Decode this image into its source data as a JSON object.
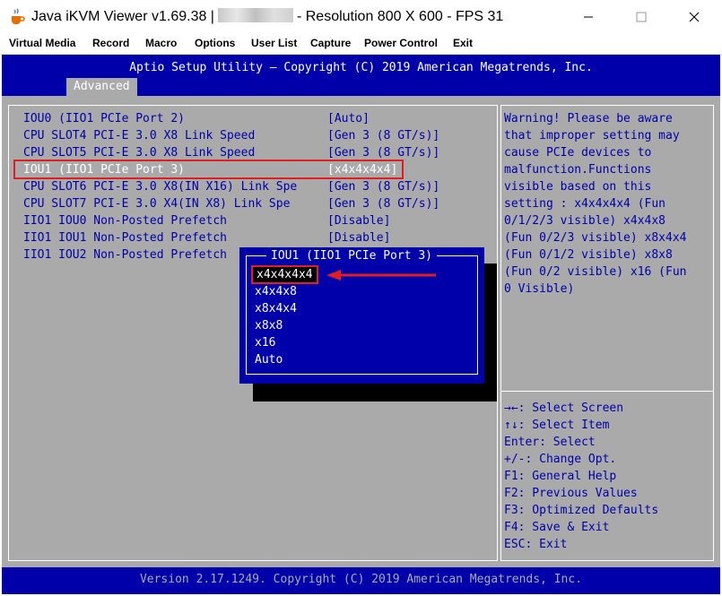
{
  "window": {
    "title_prefix": "Java iKVM Viewer v1.69.38 |",
    "title_suffix": "- Resolution 800 X 600 - FPS 31",
    "icon": "java-cup-icon"
  },
  "menu": [
    "Virtual Media",
    "Record",
    "Macro",
    "Options",
    "User List",
    "Capture",
    "Power Control",
    "Exit"
  ],
  "bios": {
    "header_title": "Aptio Setup Utility – Copyright (C) 2019 American Megatrends, Inc.",
    "tab": "Advanced",
    "footer": "Version 2.17.1249. Copyright (C) 2019 American Megatrends, Inc.",
    "settings": [
      {
        "label": "IOU0 (IIO1 PCIe Port 2)",
        "value": "[Auto]"
      },
      {
        "label": "CPU SLOT4 PCI-E 3.0 X8 Link Speed",
        "value": "[Gen 3 (8 GT/s)]"
      },
      {
        "label": "CPU SLOT5 PCI-E 3.0 X8 Link Speed",
        "value": "[Gen 3 (8 GT/s)]"
      },
      {
        "label": "IOU1 (IIO1 PCIe Port 3)",
        "value": "[x4x4x4x4]"
      },
      {
        "label": "CPU SLOT6 PCI-E 3.0 X8(IN X16) Link Spe",
        "value": "[Gen 3 (8 GT/s)]"
      },
      {
        "label": "CPU SLOT7 PCI-E 3.0 X4(IN X8) Link Spe",
        "value": "[Gen 3 (8 GT/s)]"
      },
      {
        "label": "IIO1 IOU0 Non-Posted Prefetch",
        "value": "[Disable]"
      },
      {
        "label": "IIO1 IOU1 Non-Posted Prefetch",
        "value": "[Disable]"
      },
      {
        "label": "IIO1 IOU2 Non-Posted Prefetch",
        "value": ""
      }
    ],
    "help": [
      "Warning! Please be aware",
      "that improper setting may",
      "cause PCIe devices to",
      "malfunction.Functions",
      "visible based on this",
      "setting : x4x4x4x4 (Fun",
      "0/1/2/3 visible) x4x4x8",
      "(Fun 0/2/3 visible) x8x4x4",
      "(Fun 0/1/2 visible) x8x8",
      "(Fun 0/2 visible) x16 (Fun",
      "0 Visible)"
    ],
    "keys": [
      "→←: Select Screen",
      "↑↓: Select Item",
      "Enter: Select",
      "+/-: Change Opt.",
      "F1: General Help",
      "F2: Previous Values",
      "F3: Optimized Defaults",
      "F4: Save & Exit",
      "ESC: Exit"
    ],
    "popup": {
      "title": "IOU1 (IIO1 PCIe Port 3)",
      "options": [
        "x4x4x4x4",
        "x4x4x8",
        "x8x4x4",
        "x8x8",
        "x16",
        "Auto"
      ]
    }
  },
  "colors": {
    "bios_blue": "#0000aa",
    "bios_gray": "#aaaaaa",
    "highlight_red": "#e02020"
  }
}
